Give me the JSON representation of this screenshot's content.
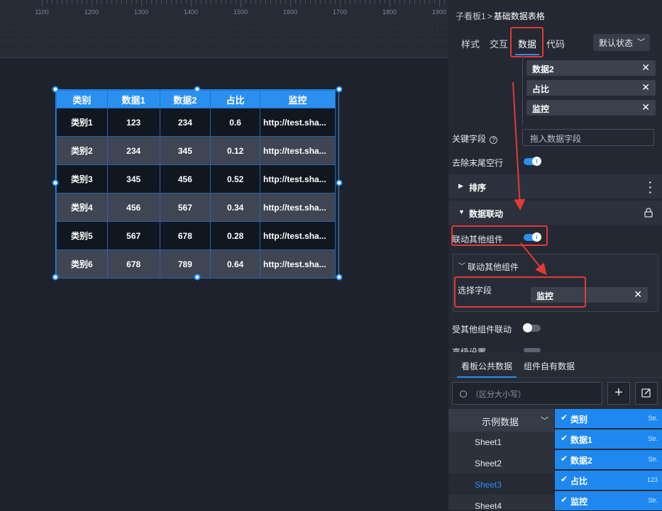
{
  "ruler": {
    "labels": [
      "1100",
      "1200",
      "1300",
      "1400",
      "1500",
      "1600",
      "1700",
      "1800",
      "1900"
    ]
  },
  "table": {
    "headers": [
      "类别",
      "数据1",
      "数据2",
      "占比",
      "监控"
    ],
    "rows": [
      [
        "类别1",
        "123",
        "234",
        "0.6",
        "http://test.sha..."
      ],
      [
        "类别2",
        "234",
        "345",
        "0.12",
        "http://test.sha..."
      ],
      [
        "类别3",
        "345",
        "456",
        "0.52",
        "http://test.sha..."
      ],
      [
        "类别4",
        "456",
        "567",
        "0.34",
        "http://test.sha..."
      ],
      [
        "类别5",
        "567",
        "678",
        "0.28",
        "http://test.sha..."
      ],
      [
        "类别6",
        "678",
        "789",
        "0.64",
        "http://test.sha..."
      ]
    ]
  },
  "panel": {
    "breadcrumb_parent": "子看板1",
    "breadcrumb_sep": ">",
    "breadcrumb_current": "基础数据表格",
    "tabs": [
      "样式",
      "交互",
      "数据",
      "代码"
    ],
    "active_tab": "数据",
    "state_select": "默认状态",
    "selected_fields": [
      "数据2",
      "占比",
      "监控"
    ],
    "key_field_label": "关键字段",
    "key_field_placeholder": "拖入数据字段",
    "remove_blank_label": "去除末尾空行",
    "sort_section": "排序",
    "linkage_section": "数据联动",
    "link_others_label": "联动其他组件",
    "sub_title": "联动其他组件",
    "select_field_label": "选择字段",
    "select_field_value": "监控",
    "receive_label": "受其他组件联动",
    "advanced_label": "高级设置"
  },
  "bottom": {
    "tabs": [
      "看板公共数据",
      "组件自有数据"
    ],
    "search_placeholder": "（区分大小写）",
    "dataset": "示例数据",
    "sheets": [
      "Sheet1",
      "Sheet2",
      "Sheet3",
      "Sheet4"
    ],
    "selected_sheet": "Sheet3",
    "fields": [
      {
        "name": "类别",
        "type": "Str."
      },
      {
        "name": "数据1",
        "type": "Str."
      },
      {
        "name": "数据2",
        "type": "Str."
      },
      {
        "name": "占比",
        "type": "123"
      },
      {
        "name": "监控",
        "type": "Str."
      }
    ]
  },
  "colors": {
    "accent": "#2b8ff0",
    "highlight": "#e53935",
    "panel_bg": "#232833",
    "canvas_bg": "#1d222c"
  }
}
